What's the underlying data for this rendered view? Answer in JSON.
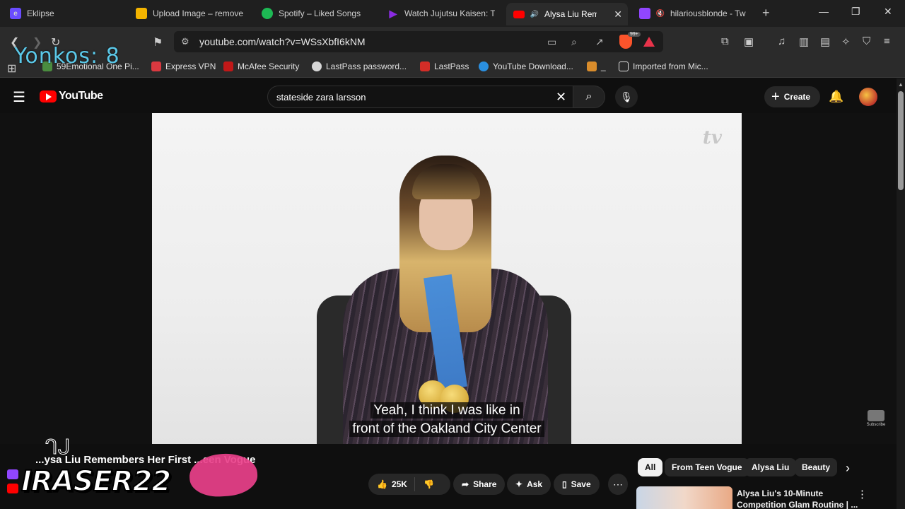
{
  "browser": {
    "tabs": [
      {
        "title": "Eklipse",
        "color": "#6a4cff"
      },
      {
        "title": "Upload Image – remove",
        "color": "#f4b400"
      },
      {
        "title": "Spotify – Liked Songs",
        "color": "#1db954"
      },
      {
        "title": "Watch Jujutsu Kaisen: Th",
        "color": "#8a2be2"
      },
      {
        "title": "Alysa Liu Remem",
        "color": "#ff0000"
      },
      {
        "title": "hilariousblonde - Tw",
        "color": "#9146ff"
      }
    ],
    "url": "youtube.com/watch?v=WSsXbfI6kNM",
    "brave_badge": "99+",
    "bookmarks": [
      {
        "label": "59Emotional One Pi...",
        "color": "#4a8c3f"
      },
      {
        "label": "Express VPN",
        "color": "#da3940"
      },
      {
        "label": "McAfee Security",
        "color": "#c01818"
      },
      {
        "label": "LastPass password...",
        "color": "#d7d7d7"
      },
      {
        "label": "LastPass",
        "color": "#d32d27"
      },
      {
        "label": "YouTube Download...",
        "color": "#2a8fe0"
      },
      {
        "label": "_",
        "color": "#d98c2b"
      },
      {
        "label": "Imported from Mic...",
        "color": "#e0e0e0"
      }
    ]
  },
  "overlay": {
    "text": "Yonkos: 8"
  },
  "youtube": {
    "logo_text": "YouTube",
    "search_query": "stateside zara larsson",
    "create_label": "Create"
  },
  "video": {
    "subtitle_line1": "Yeah, I think I was like in",
    "subtitle_line2": "front of the Oakland City Center",
    "watermark": "tv",
    "channel_badge": "Subscribe",
    "title": "...ysa Liu Remembers Her First ...een Vogue",
    "streamer_name": "IRASER22",
    "likes": "25K",
    "share_label": "Share",
    "ask_label": "Ask",
    "save_label": "Save"
  },
  "chips": [
    "All",
    "From Teen Vogue",
    "Alysa Liu",
    "Beauty"
  ],
  "recommendation": {
    "title": "Alysa Liu's 10-Minute Competition Glam Routine | ..."
  }
}
